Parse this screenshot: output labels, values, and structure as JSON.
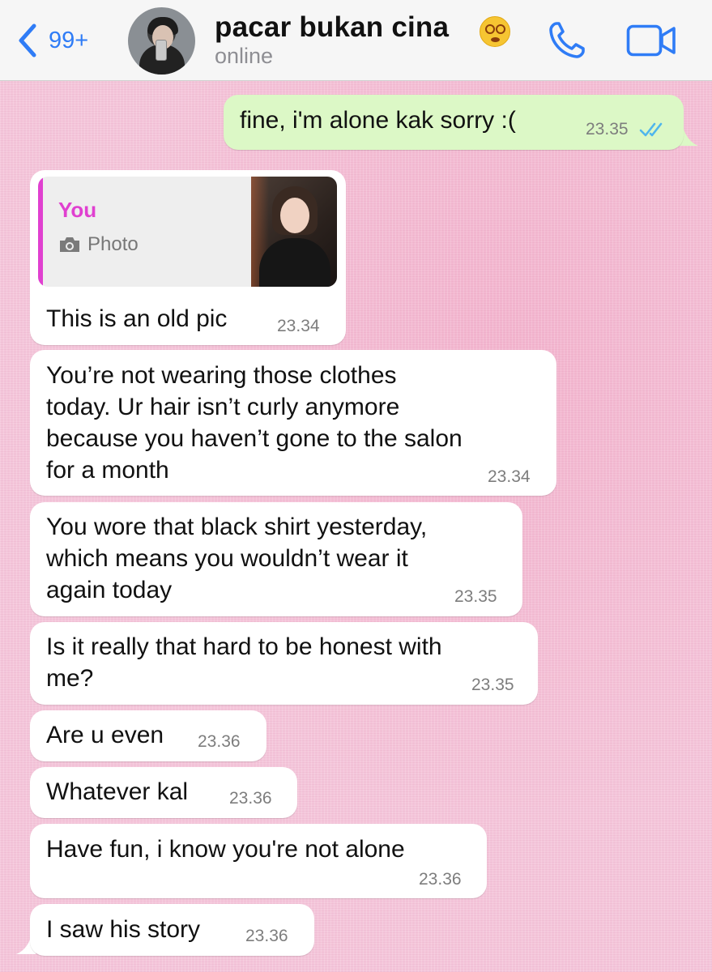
{
  "header": {
    "back_count": "99+",
    "contact_name": "pacar bukan cina",
    "status": "online"
  },
  "colors": {
    "accent": "#2f7cf6",
    "outgoing_bubble": "#dcf8c6",
    "incoming_bubble": "#ffffff",
    "quote_author": "#e040d0",
    "read_ticks": "#4fb6ec"
  },
  "icons": {
    "back": "chevron-left-icon",
    "status_emoji": "dizzy-face-emoji",
    "call": "phone-icon",
    "video": "video-camera-icon",
    "quote_type": "camera-icon",
    "read_receipt": "double-check-icon"
  },
  "messages": [
    {
      "direction": "out",
      "lines": [
        "fine, i'm alone kak sorry :("
      ],
      "time": "23.35",
      "read": true
    },
    {
      "direction": "in",
      "quote": {
        "author": "You",
        "type": "Photo"
      },
      "lines": [
        "This is an old pic"
      ],
      "time": "23.34"
    },
    {
      "direction": "in",
      "lines": [
        "You’re not wearing those clothes",
        "today. Ur hair isn’t curly anymore",
        "because you haven’t gone to the salon",
        "for a month"
      ],
      "time": "23.34"
    },
    {
      "direction": "in",
      "lines": [
        "You wore that black shirt yesterday,",
        "which means you wouldn’t wear it",
        "again today"
      ],
      "time": "23.35"
    },
    {
      "direction": "in",
      "lines": [
        "Is it really that hard to be honest with",
        "me?"
      ],
      "time": "23.35"
    },
    {
      "direction": "in",
      "lines": [
        "Are u even"
      ],
      "time": "23.36"
    },
    {
      "direction": "in",
      "lines": [
        "Whatever kal"
      ],
      "time": "23.36"
    },
    {
      "direction": "in",
      "lines": [
        "Have fun, i know you're not alone"
      ],
      "time": "23.36"
    },
    {
      "direction": "in",
      "lines": [
        "I saw his story"
      ],
      "time": "23.36"
    }
  ]
}
